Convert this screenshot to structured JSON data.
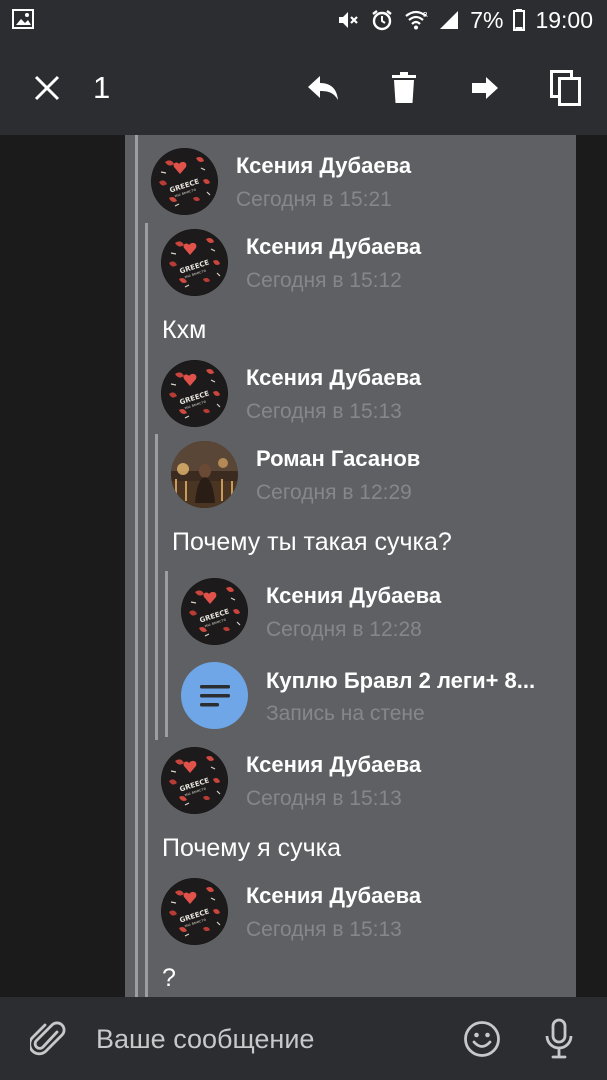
{
  "status_bar": {
    "battery": "7%",
    "time": "19:00",
    "icons": [
      "gallery-icon",
      "mute-icon",
      "alarm-icon",
      "wifi-icon",
      "signal-icon",
      "battery-icon"
    ]
  },
  "action_bar": {
    "selected_count": "1",
    "icons": [
      "close-icon",
      "reply-icon",
      "delete-icon",
      "forward-icon",
      "copy-icon"
    ]
  },
  "messages": {
    "m1": {
      "name": "Ксения Дубаева",
      "time": "Сегодня в 15:21"
    },
    "m2": {
      "name": "Ксения Дубаева",
      "time": "Сегодня в 15:12",
      "text": "Кхм"
    },
    "m3": {
      "name": "Ксения Дубаева",
      "time": "Сегодня в 15:13"
    },
    "m4": {
      "name": "Роман Гасанов",
      "time": "Сегодня в 12:29",
      "text": "Почему ты такая сучка?"
    },
    "m5": {
      "name": "Ксения Дубаева",
      "time": "Сегодня в 12:28"
    },
    "wall": {
      "title": "Куплю Бравл 2 леги+ 8...",
      "subtitle": "Запись на стене",
      "icon": "document-icon"
    },
    "m6": {
      "name": "Ксения Дубаева",
      "time": "Сегодня в 15:13",
      "text": "Почему я сучка"
    },
    "m7": {
      "name": "Ксения Дубаева",
      "time": "Сегодня в 15:13",
      "text": "?"
    }
  },
  "avatar_logo_text": "GREECE",
  "input_bar": {
    "placeholder": "Ваше сообщение",
    "icons": [
      "attach-icon",
      "emoji-icon",
      "microphone-icon"
    ]
  },
  "colors": {
    "panel_bg": "#5f6063",
    "bar_bg": "#2b2d30",
    "thread_line": "#9c9ea2",
    "time_text": "#85878b",
    "wall_icon_bg": "#6ea6e8"
  }
}
